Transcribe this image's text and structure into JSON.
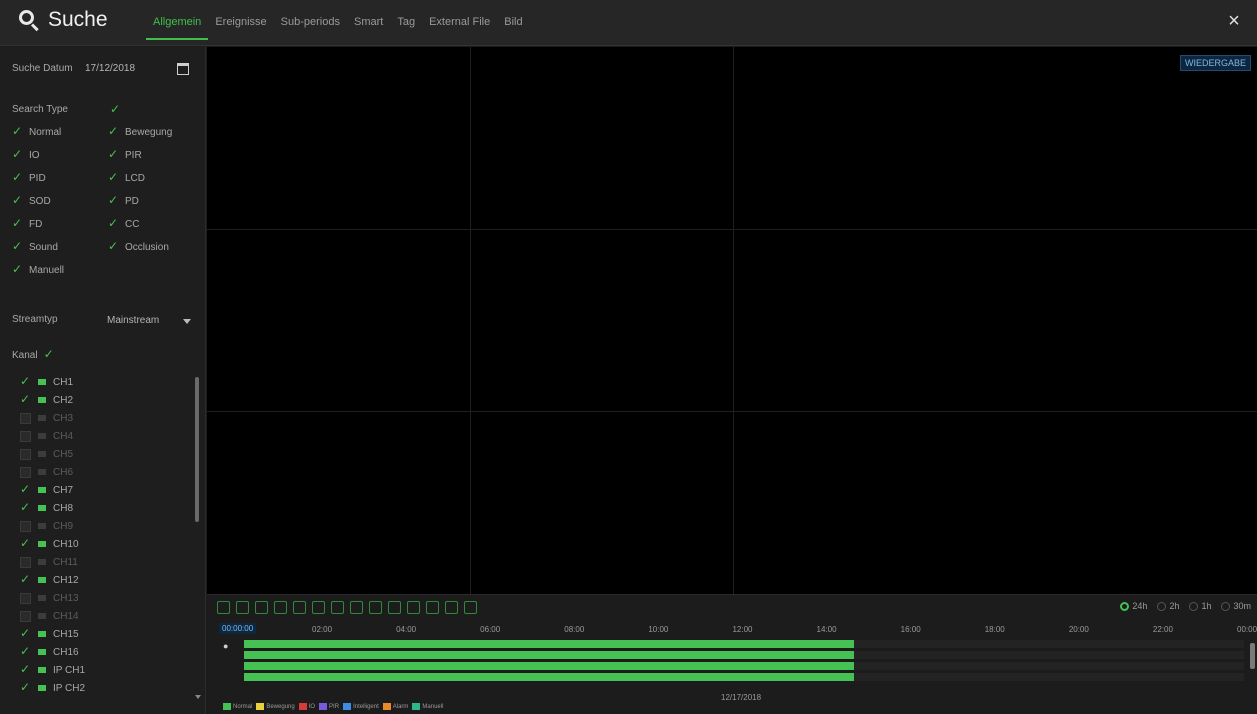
{
  "header": {
    "title": "Suche",
    "tabs": [
      {
        "label": "Allgemein",
        "active": true
      },
      {
        "label": "Ereignisse",
        "active": false
      },
      {
        "label": "Sub-periods",
        "active": false
      },
      {
        "label": "Smart",
        "active": false
      },
      {
        "label": "Tag",
        "active": false
      },
      {
        "label": "External File",
        "active": false
      },
      {
        "label": "Bild",
        "active": false
      }
    ],
    "close_label": "×"
  },
  "sidebar": {
    "date_label": "Suche Datum",
    "date_value": "17/12/2018",
    "search_type_label": "Search Type",
    "types": [
      {
        "label": "Normal",
        "checked": true
      },
      {
        "label": "Bewegung",
        "checked": true
      },
      {
        "label": "IO",
        "checked": true
      },
      {
        "label": "PIR",
        "checked": true
      },
      {
        "label": "PID",
        "checked": true
      },
      {
        "label": "LCD",
        "checked": true
      },
      {
        "label": "SOD",
        "checked": true
      },
      {
        "label": "PD",
        "checked": true
      },
      {
        "label": "FD",
        "checked": true
      },
      {
        "label": "CC",
        "checked": true
      },
      {
        "label": "Sound",
        "checked": true
      },
      {
        "label": "Occlusion",
        "checked": true
      },
      {
        "label": "Manuell",
        "checked": true
      }
    ],
    "stream_label": "Streamtyp",
    "stream_value": "Mainstream",
    "channel_label": "Kanal",
    "channels": [
      {
        "label": "CH1",
        "on": true
      },
      {
        "label": "CH2",
        "on": true
      },
      {
        "label": "CH3",
        "on": false
      },
      {
        "label": "CH4",
        "on": false
      },
      {
        "label": "CH5",
        "on": false
      },
      {
        "label": "CH6",
        "on": false
      },
      {
        "label": "CH7",
        "on": true
      },
      {
        "label": "CH8",
        "on": true
      },
      {
        "label": "CH9",
        "on": false
      },
      {
        "label": "CH10",
        "on": true
      },
      {
        "label": "CH11",
        "on": false
      },
      {
        "label": "CH12",
        "on": true
      },
      {
        "label": "CH13",
        "on": false
      },
      {
        "label": "CH14",
        "on": false
      },
      {
        "label": "CH15",
        "on": true
      },
      {
        "label": "CH16",
        "on": true
      },
      {
        "label": "IP CH1",
        "on": true
      },
      {
        "label": "IP CH2",
        "on": true
      }
    ]
  },
  "video": {
    "playback_label": "WIEDERGABE"
  },
  "timeline": {
    "cursor_time": "00:00:00",
    "ticks": [
      "02:00",
      "04:00",
      "06:00",
      "08:00",
      "10:00",
      "12:00",
      "14:00",
      "16:00",
      "18:00",
      "20:00",
      "22:00",
      "00:00"
    ],
    "date_label": "12/17/2018",
    "range_options": [
      {
        "label": "24h",
        "selected": true
      },
      {
        "label": "2h",
        "selected": false
      },
      {
        "label": "1h",
        "selected": false
      },
      {
        "label": "30m",
        "selected": false
      }
    ],
    "recorded_fraction": 0.61,
    "legend": [
      {
        "label": "Normal",
        "color": "#46c153"
      },
      {
        "label": "Bewegung",
        "color": "#e8d13c"
      },
      {
        "label": "IO",
        "color": "#d63a3a"
      },
      {
        "label": "PIR",
        "color": "#7a5ad8"
      },
      {
        "label": "Intelligent",
        "color": "#3a8ee6"
      },
      {
        "label": "Alarm",
        "color": "#e88a2a"
      },
      {
        "label": "Manuell",
        "color": "#2fb58a"
      }
    ]
  }
}
